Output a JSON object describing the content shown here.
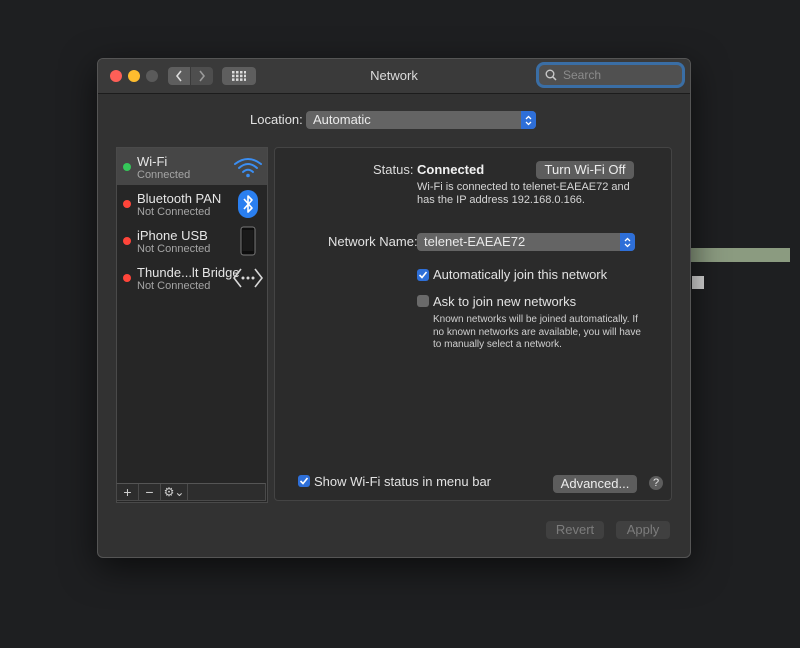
{
  "window": {
    "title": "Network"
  },
  "search": {
    "placeholder": "Search"
  },
  "location": {
    "label": "Location:",
    "value": "Automatic"
  },
  "services": [
    {
      "name": "Wi-Fi",
      "status": "Connected",
      "dot_color": "#35c759",
      "icon": "wifi-icon"
    },
    {
      "name": "Bluetooth PAN",
      "status": "Not Connected",
      "dot_color": "#ff453a",
      "icon": "bluetooth-icon"
    },
    {
      "name": "iPhone USB",
      "status": "Not Connected",
      "dot_color": "#ff453a",
      "icon": "iphone-icon"
    },
    {
      "name": "Thunde...lt Bridge",
      "status": "Not Connected",
      "dot_color": "#ff453a",
      "icon": "thunderbolt-bridge-icon"
    }
  ],
  "sidebar_footer": {
    "add": "+",
    "remove": "−",
    "gear": "⚙︎⌄"
  },
  "detail": {
    "status_label": "Status:",
    "status_value": "Connected",
    "turn_off_button": "Turn Wi-Fi Off",
    "status_description": "Wi-Fi is connected to telenet-EAEAE72 and has the IP address 192.168.0.166.",
    "network_name_label": "Network Name:",
    "network_name_value": "telenet-EAEAE72",
    "auto_join": {
      "label": "Automatically join this network",
      "checked": true
    },
    "ask_join": {
      "label": "Ask to join new networks",
      "checked": false
    },
    "ask_join_help": "Known networks will be joined automatically. If no known networks are available, you will have to manually select a network.",
    "show_status": {
      "label": "Show Wi-Fi status in menu bar",
      "checked": true
    },
    "advanced_button": "Advanced...",
    "help_button": "?"
  },
  "footer": {
    "revert": "Revert",
    "apply": "Apply"
  },
  "colors": {
    "accent": "#2e6fd8",
    "connected": "#35c759",
    "disconnected": "#ff453a"
  }
}
